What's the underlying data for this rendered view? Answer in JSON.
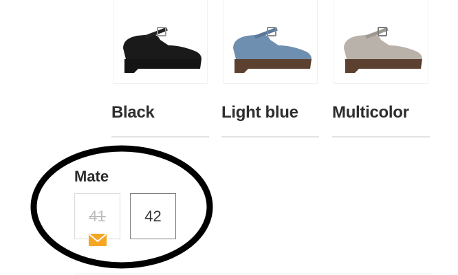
{
  "variants": [
    {
      "name": "Black",
      "shoe_color": "#1a1a1a",
      "sole_color": "#141414",
      "icon": "shoe-black-image"
    },
    {
      "name": "Light blue",
      "shoe_color": "#6f8fb0",
      "sole_color": "#5c4130",
      "icon": "shoe-light-blue-image"
    },
    {
      "name": "Multicolor",
      "shoe_color": "#b9b2aa",
      "sole_color": "#5c4130",
      "icon": "shoe-multicolor-image"
    }
  ],
  "sizes": {
    "label": "Mate",
    "options": [
      {
        "value": "41",
        "available": false,
        "notify_icon": "mail-icon"
      },
      {
        "value": "42",
        "available": true
      }
    ]
  },
  "colors": {
    "annotation_ellipse": "#000000",
    "mail_icon": "#f5a623"
  }
}
